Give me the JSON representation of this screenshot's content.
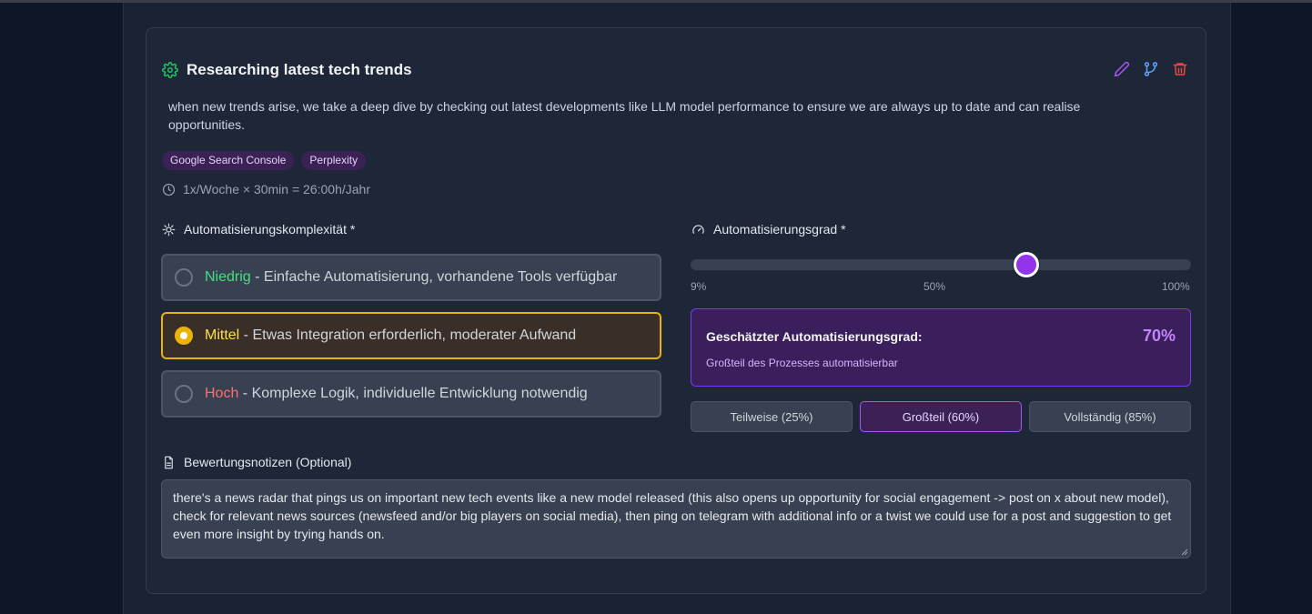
{
  "task": {
    "title": "Researching latest tech trends",
    "description": "when new trends arise, we take a deep dive by checking out latest developments like LLM model performance to ensure we are always up to date and can realise opportunities.",
    "tags": [
      "Google Search Console",
      "Perplexity"
    ],
    "time_summary": "1x/Woche × 30min = 26:00h/Jahr",
    "icons": {
      "title": "gear-icon",
      "edit": "pencil-icon",
      "branch": "git-branch-icon",
      "delete": "trash-icon",
      "time": "clock-icon"
    }
  },
  "complexity": {
    "label": "Automatisierungskomplexität *",
    "options": [
      {
        "level": "Niedrig",
        "separator": " - ",
        "description": "Einfache Automatisierung, vorhandene Tools verfügbar",
        "selected": false
      },
      {
        "level": "Mittel",
        "separator": " - ",
        "description": "Etwas Integration erforderlich, moderater Aufwand",
        "selected": true
      },
      {
        "level": "Hoch",
        "separator": " - ",
        "description": "Komplexe Logik, individuelle Entwicklung notwendig",
        "selected": false
      }
    ],
    "colors": {
      "low": "#4ade80",
      "mid": "#fde047",
      "high": "#f87171",
      "selected_border": "#eab308"
    }
  },
  "automation": {
    "label": "Automatisierungsgrad *",
    "slider": {
      "min": 9,
      "max": 100,
      "value": 70
    },
    "ticks": [
      "9%",
      "50%",
      "100%"
    ],
    "estimate_title": "Geschätzter Automatisierungsgrad:",
    "estimate_value": "70%",
    "estimate_subtitle": "Großteil des Prozesses automatisierbar",
    "presets": [
      {
        "label": "Teilweise (25%)",
        "active": false
      },
      {
        "label": "Großteil (60%)",
        "active": true
      },
      {
        "label": "Vollständig (85%)",
        "active": false
      }
    ],
    "accent": "#9333ea"
  },
  "notes": {
    "label": "Bewertungsnotizen (Optional)",
    "value": "there's a news radar that pings us on important new tech events like a new model released (this also opens up opportunity for social engagement -> post on x about new model), check for relevant news sources (newsfeed and/or big players on social media), then ping on telegram with additional info or a twist we could use for a post and suggestion to get even more insight by trying hands on."
  }
}
